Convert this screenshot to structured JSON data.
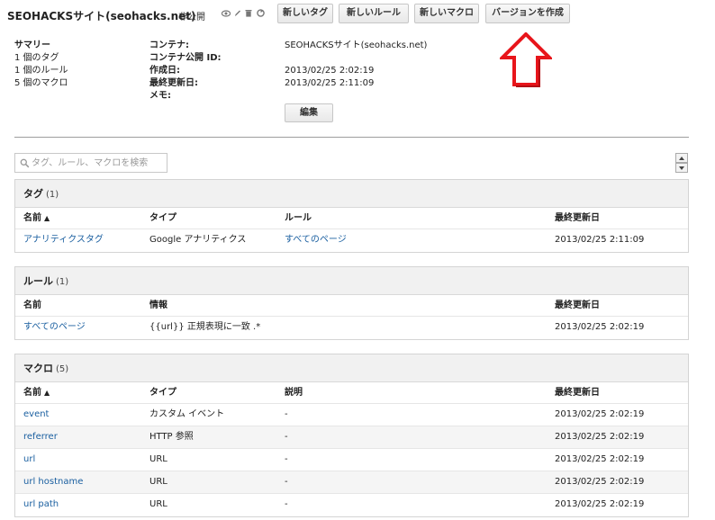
{
  "header": {
    "title": "SEOHACKSサイト(seohacks.net)",
    "status": "非公開",
    "icons": [
      "eye-icon",
      "pencil-icon",
      "trash-icon",
      "share-icon"
    ],
    "buttons": {
      "new_tag": "新しいタグ",
      "new_rule": "新しいルール",
      "new_macro": "新しいマクロ",
      "create_version": "バージョンを作成"
    }
  },
  "annotation": {
    "color": "#e8151b"
  },
  "summary": {
    "heading": "サマリー",
    "tags": "1 個のタグ",
    "rules": "1 個のルール",
    "macros": "5 個のマクロ"
  },
  "container_info": {
    "labels": {
      "container": "コンテナ:",
      "public_id": "コンテナ公開 ID:",
      "created": "作成日:",
      "updated": "最終更新日:",
      "memo": "メモ:"
    },
    "values": {
      "container": "SEOHACKSサイト(seohacks.net)",
      "public_id": "",
      "created": "2013/02/25 2:02:19",
      "updated": "2013/02/25 2:11:09",
      "memo": ""
    },
    "edit_label": "編集"
  },
  "search": {
    "placeholder": "タグ、ルール、マクロを検索"
  },
  "tags_panel": {
    "title": "タグ",
    "count": "(1)",
    "columns": [
      "名前",
      "タイプ",
      "ルール",
      "最終更新日"
    ],
    "sort_indicator": "▲",
    "rows": [
      {
        "name": "アナリティクスタグ",
        "type": "Google アナリティクス",
        "rule": "すべてのページ",
        "updated": "2013/02/25 2:11:09"
      }
    ]
  },
  "rules_panel": {
    "title": "ルール",
    "count": "(1)",
    "columns": [
      "名前",
      "情報",
      "最終更新日"
    ],
    "rows": [
      {
        "name": "すべてのページ",
        "info": "{{url}} 正規表現に一致 .*",
        "updated": "2013/02/25 2:02:19"
      }
    ]
  },
  "macros_panel": {
    "title": "マクロ",
    "count": "(5)",
    "columns": [
      "名前",
      "タイプ",
      "説明",
      "最終更新日"
    ],
    "sort_indicator": "▲",
    "rows": [
      {
        "name": "event",
        "type": "カスタム イベント",
        "desc": "-",
        "updated": "2013/02/25 2:02:19"
      },
      {
        "name": "referrer",
        "type": "HTTP 参照",
        "desc": "-",
        "updated": "2013/02/25 2:02:19"
      },
      {
        "name": "url",
        "type": "URL",
        "desc": "-",
        "updated": "2013/02/25 2:02:19"
      },
      {
        "name": "url hostname",
        "type": "URL",
        "desc": "-",
        "updated": "2013/02/25 2:02:19"
      },
      {
        "name": "url path",
        "type": "URL",
        "desc": "-",
        "updated": "2013/02/25 2:02:19"
      }
    ]
  }
}
